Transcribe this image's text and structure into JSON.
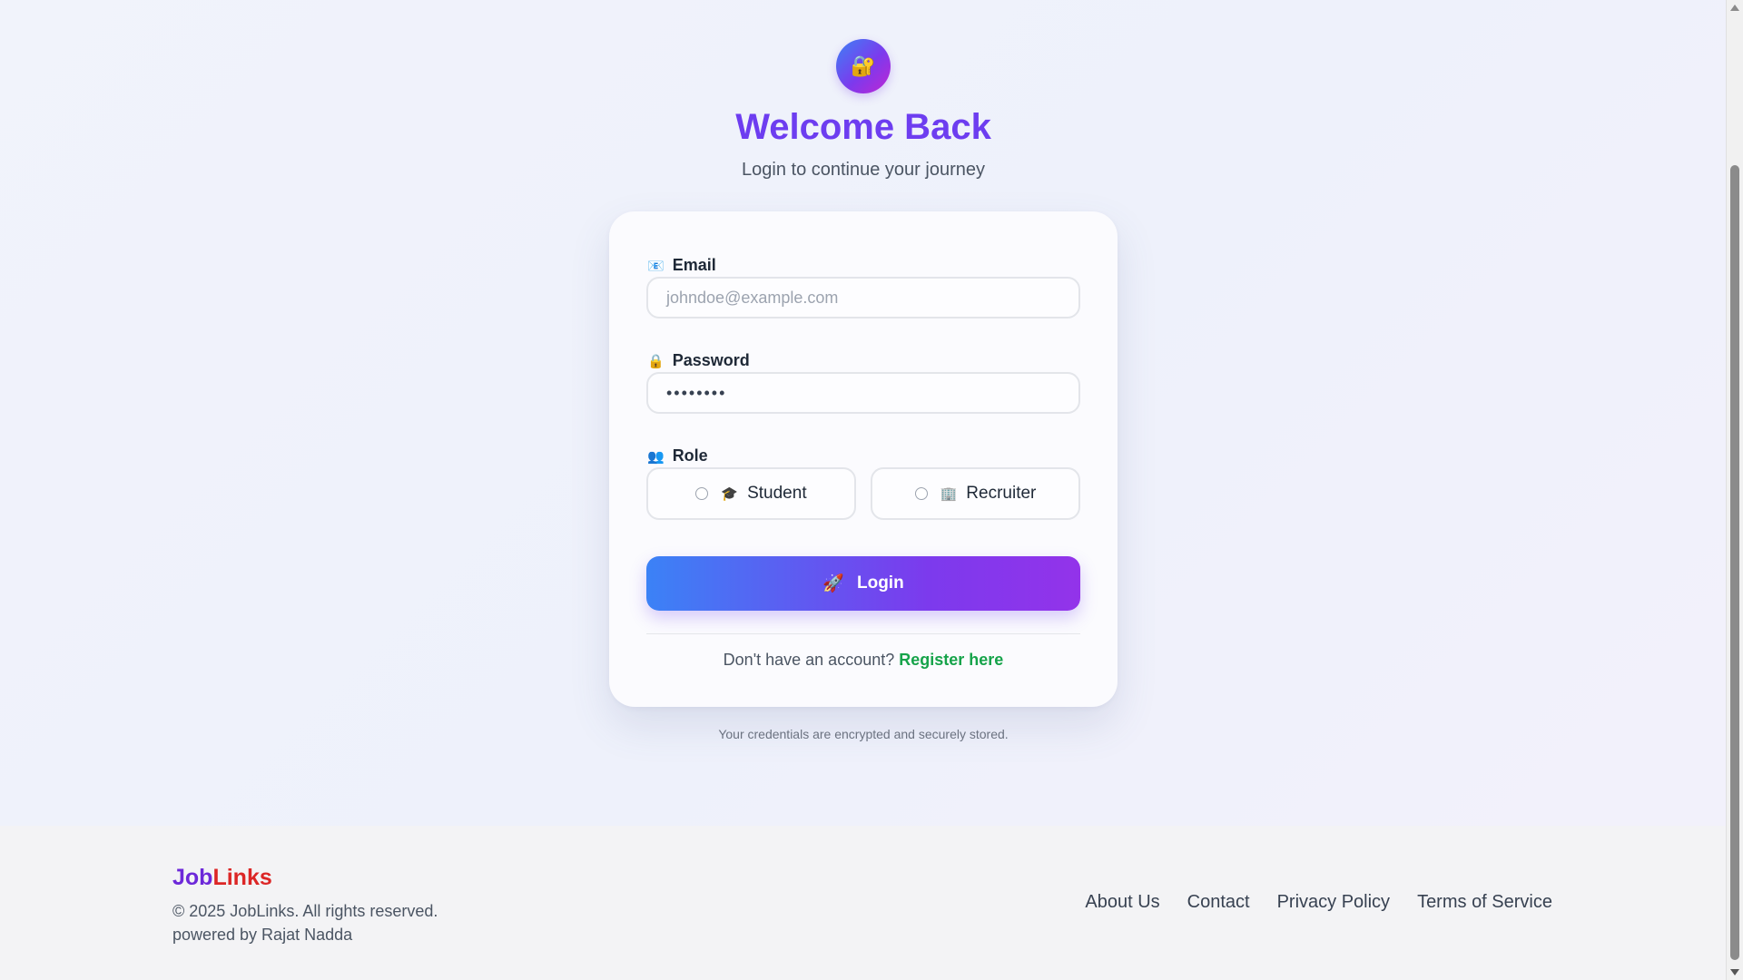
{
  "header": {
    "lock_icon": "🔐",
    "title": "Welcome Back",
    "subtitle": "Login to continue your journey"
  },
  "form": {
    "email": {
      "icon": "📧",
      "label": "Email",
      "placeholder": "johndoe@example.com",
      "value": ""
    },
    "password": {
      "icon": "🔒",
      "label": "Password",
      "value": "••••••••"
    },
    "role": {
      "icon": "👥",
      "label": "Role",
      "options": [
        {
          "icon": "🎓",
          "label": "Student",
          "selected": false
        },
        {
          "icon": "🏢",
          "label": "Recruiter",
          "selected": false
        }
      ]
    },
    "login_button": {
      "icon": "🚀",
      "label": "Login"
    },
    "register": {
      "prompt": "Don't have an account?",
      "link": "Register here"
    }
  },
  "secure_note": "Your credentials are encrypted and securely stored.",
  "footer": {
    "brand_part1": "Job",
    "brand_part2": "Links",
    "copyright": "© 2025 JobLinks. All rights reserved.",
    "powered_by": "powered by Rajat Nadda",
    "links": [
      "About Us",
      "Contact",
      "Privacy Policy",
      "Terms of Service"
    ]
  },
  "colors": {
    "accent_purple": "#6d3df0",
    "accent_blue": "#3b82f6",
    "link_green": "#16a34a",
    "brand_red": "#dc2626"
  }
}
